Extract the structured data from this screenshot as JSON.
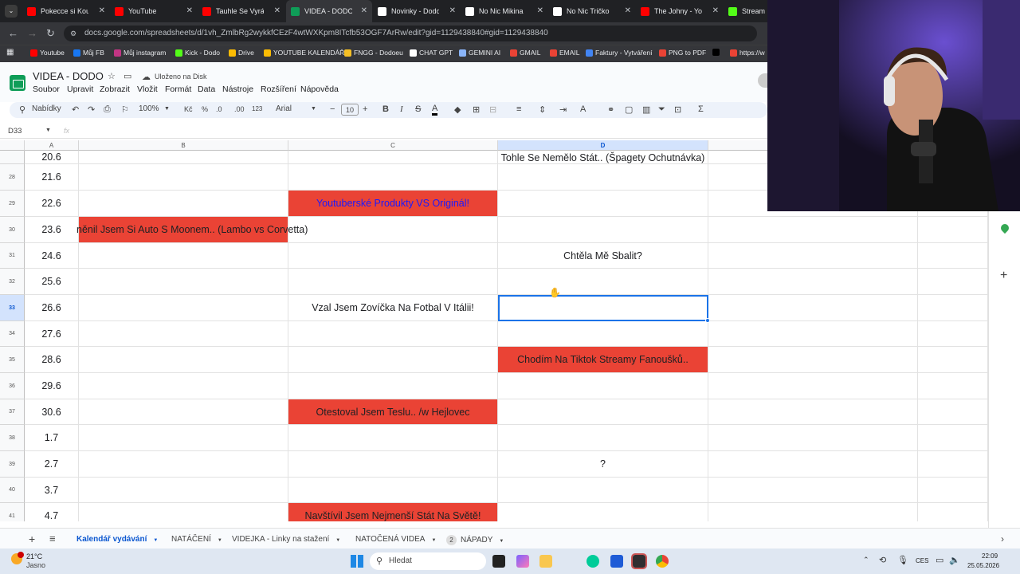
{
  "browser": {
    "tabs": [
      {
        "title": "Pokecce si Koupil",
        "color": "#ff0000"
      },
      {
        "title": "YouTube",
        "color": "#ff0000"
      },
      {
        "title": "Tauhle Se Vyrábí",
        "color": "#ff0000"
      },
      {
        "title": "VIDEA - DODO",
        "color": "#0f9d58",
        "active": true
      },
      {
        "title": "Novinky - Dodo",
        "color": "#ffffff"
      },
      {
        "title": "No Nic Mikina",
        "color": "#ffffff"
      },
      {
        "title": "No Nic Tričko",
        "color": "#ffffff"
      },
      {
        "title": "The Johny - YouTube",
        "color": "#ff0000"
      },
      {
        "title": "Stream",
        "color": "#53fc18"
      }
    ],
    "url": "docs.google.com/spreadsheets/d/1vh_ZmlbRg2wykkfCEzF4wtWXKpm8ITcfb53OGF7ArRw/edit?gid=1129438840#gid=1129438840",
    "bookmarks": [
      {
        "label": "Youtube",
        "color": "#ff0000"
      },
      {
        "label": "Můj FB",
        "color": "#1877f2"
      },
      {
        "label": "Můj instagram",
        "color": "#c13584"
      },
      {
        "label": "Kick - Dodo",
        "color": "#53fc18"
      },
      {
        "label": "Drive",
        "color": "#fbbc04"
      },
      {
        "label": "YOUTUBE KALENDÁŘ",
        "color": "#fbbc04"
      },
      {
        "label": "FNGG - Dodoeu",
        "color": "#f6c026"
      },
      {
        "label": "CHAT GPT",
        "color": "#ffffff"
      },
      {
        "label": "GEMINI AI",
        "color": "#8ab4f8"
      },
      {
        "label": "GMAIL",
        "color": "#ea4335"
      },
      {
        "label": "EMAIL",
        "color": "#ea4335"
      },
      {
        "label": "Faktury - Vytváření",
        "color": "#4285f4"
      },
      {
        "label": "PNG to PDF",
        "color": "#ea4335"
      },
      {
        "label": "",
        "color": "#000000"
      },
      {
        "label": "https://w",
        "color": "#ea4335"
      }
    ]
  },
  "doc": {
    "title": "VIDEA - DODO",
    "saved": "Uloženo na Disk",
    "menus": [
      "Soubor",
      "Upravit",
      "Zobrazit",
      "Vložit",
      "Formát",
      "Data",
      "Nástroje",
      "Rozšíření",
      "Nápověda"
    ],
    "toolbar": {
      "search": "Nabídky",
      "zoom": "100%",
      "currency": "Kč",
      "percent": "%",
      "dec_less": ".0",
      "dec_more": ".00",
      "numfmt": "123",
      "font": "Arial",
      "font_size": "10"
    },
    "name_box": "D33",
    "fx": "fx"
  },
  "grid": {
    "columns": [
      "A",
      "B",
      "C",
      "D"
    ],
    "selected_column": "D",
    "selected_row": "33",
    "rows": [
      {
        "num": "",
        "a": "20.6",
        "b": "",
        "c": "",
        "d": "Tohle Se Nemělo Stát.. (Špagety Ochutnávka)"
      },
      {
        "num": "28",
        "a": "21.6",
        "b": "",
        "c": "",
        "d": ""
      },
      {
        "num": "29",
        "a": "22.6",
        "b": "",
        "c": "Youtuberské Produkty VS Originál!",
        "d": ""
      },
      {
        "num": "30",
        "a": "23.6",
        "b": "něnil Jsem Si Auto S Moonem.. (Lambo vs Corvetta)",
        "c": "",
        "d": ""
      },
      {
        "num": "31",
        "a": "24.6",
        "b": "",
        "c": "",
        "d": "Chtěla Mě Sbalit?"
      },
      {
        "num": "32",
        "a": "25.6",
        "b": "",
        "c": "",
        "d": ""
      },
      {
        "num": "33",
        "a": "26.6",
        "b": "",
        "c": "Vzal Jsem Zovíčka Na Fotbal V Itálii!",
        "d": ""
      },
      {
        "num": "34",
        "a": "27.6",
        "b": "",
        "c": "",
        "d": ""
      },
      {
        "num": "35",
        "a": "28.6",
        "b": "",
        "c": "",
        "d": "Chodím Na Tiktok Streamy Fanoušků.."
      },
      {
        "num": "36",
        "a": "29.6",
        "b": "",
        "c": "",
        "d": ""
      },
      {
        "num": "37",
        "a": "30.6",
        "b": "",
        "c": "Otestoval Jsem Teslu.. /w Hejlovec",
        "d": ""
      },
      {
        "num": "38",
        "a": "1.7",
        "b": "",
        "c": "",
        "d": ""
      },
      {
        "num": "39",
        "a": "2.7",
        "b": "",
        "c": "",
        "d": "?"
      },
      {
        "num": "40",
        "a": "3.7",
        "b": "",
        "c": "",
        "d": ""
      },
      {
        "num": "41",
        "a": "4.7",
        "b": "",
        "c": "Navštívil Jsem Nejmenší Stát Na Světě!",
        "d": ""
      }
    ],
    "red_cells": [
      "29-c",
      "30-b",
      "35-d",
      "37-c",
      "41-c"
    ],
    "blue_text_cells": [
      "29-c"
    ],
    "highlight_color": "#ea4335"
  },
  "sheets": {
    "tabs": [
      {
        "label": "Kalendář vydávání",
        "active": true
      },
      {
        "label": "NATÁČENÍ"
      },
      {
        "label": "VIDEJKA - Linky na stažení"
      },
      {
        "label": "NATOČENÁ VIDEA"
      },
      {
        "label": "NÁPADY",
        "badge": "2"
      }
    ]
  },
  "taskbar": {
    "weather_temp": "21°C",
    "weather_text": "Jasno",
    "search": "Hledat",
    "lang": "CES",
    "time": "22:09",
    "date": "25.05.2026"
  }
}
